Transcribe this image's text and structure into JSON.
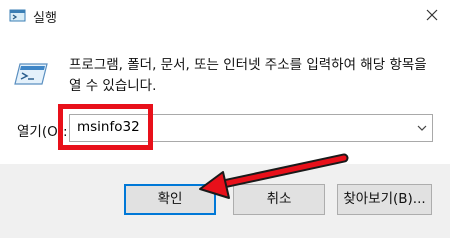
{
  "window": {
    "title": "실행",
    "title_icon": "run-icon",
    "close_icon": "close-icon"
  },
  "content": {
    "description": "프로그램, 폴더, 문서, 또는 인터넷 주소를 입력하여 해당 항목을 열 수 있습니다.",
    "prompt_icon": "run-prompt-icon",
    "open_label": "열기(O):",
    "open_value": "msinfo32"
  },
  "buttons": {
    "ok": "확인",
    "cancel": "취소",
    "browse": "찾아보기(B)..."
  },
  "annotation": {
    "highlight_color": "#e8101a"
  }
}
